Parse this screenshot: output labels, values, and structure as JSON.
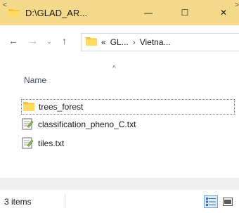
{
  "window": {
    "title": "D:\\GLAD_AR...",
    "minimize_glyph": "—",
    "maximize_glyph": "☐",
    "close_glyph": "✕"
  },
  "nav": {
    "back_glyph": "←",
    "forward_glyph": "→",
    "recent_glyph": "⌄",
    "up_glyph": "↑",
    "address_overflow": "«",
    "breadcrumbs": [
      "GL...",
      "Vietna..."
    ],
    "crumb_separator": "›"
  },
  "columns": {
    "name_label": "Name",
    "sort_glyph": "^"
  },
  "files": [
    {
      "name": "trees_forest",
      "icon": "folder-icon"
    },
    {
      "name": "classification_pheno_C.txt",
      "icon": "text-file-icon"
    },
    {
      "name": "tiles.txt",
      "icon": "text-file-icon"
    }
  ],
  "scrollbar": {
    "left_glyph": "<",
    "right_glyph": ">"
  },
  "status": {
    "item_count": "3 items"
  },
  "colors": {
    "titlebar": "#f5d98a",
    "folder": "#f3c13a",
    "selection_border": "#6aa7e6"
  }
}
